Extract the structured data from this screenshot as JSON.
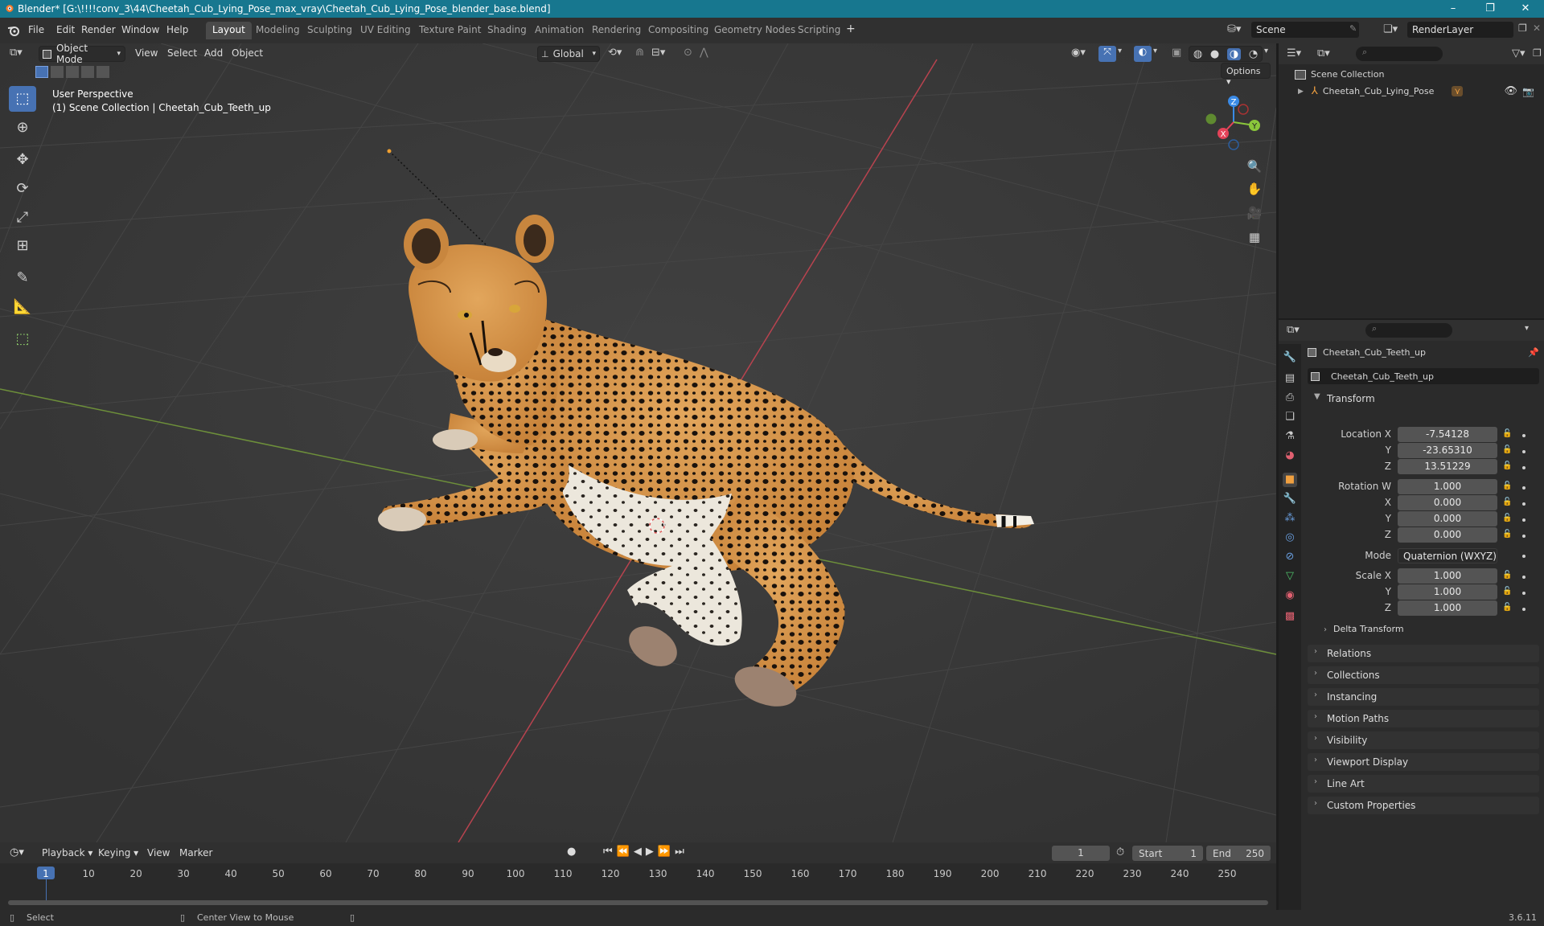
{
  "window": {
    "title": "Blender* [G:\\!!!!conv_3\\44\\Cheetah_Cub_Lying_Pose_max_vray\\Cheetah_Cub_Lying_Pose_blender_base.blend]",
    "controls": [
      "–",
      "❐",
      "✕"
    ]
  },
  "menubar": {
    "menus": [
      "File",
      "Edit",
      "Render",
      "Window",
      "Help"
    ],
    "workspaces": [
      "Layout",
      "Modeling",
      "Sculpting",
      "UV Editing",
      "Texture Paint",
      "Shading",
      "Animation",
      "Rendering",
      "Compositing",
      "Geometry Nodes",
      "Scripting"
    ],
    "active_workspace": "Layout",
    "add_workspace": "+",
    "scene": "Scene",
    "render_layer": "RenderLayer"
  },
  "viewport": {
    "mode": "Object Mode",
    "menus": [
      "View",
      "Select",
      "Add",
      "Object"
    ],
    "orientation": "Global",
    "options": "Options",
    "perspective_label": "User Perspective",
    "collection_label": "(1) Scene Collection | Cheetah_Cub_Teeth_up",
    "gizmo_axes": {
      "x": "X",
      "y": "Y",
      "z": "Z"
    }
  },
  "outliner": {
    "root": "Scene Collection",
    "items": [
      {
        "label": "Cheetah_Cub_Lying_Pose"
      }
    ]
  },
  "properties": {
    "object_name": "Cheetah_Cub_Teeth_up",
    "data_name": "Cheetah_Cub_Teeth_up",
    "transform": {
      "header": "Transform",
      "location_label": "Location X",
      "location": [
        "-7.54128",
        "-23.65310",
        "13.51229"
      ],
      "rotation_label": "Rotation W",
      "rotation": [
        "1.000",
        "0.000",
        "0.000",
        "0.000"
      ],
      "mode_label": "Mode",
      "mode": "Quaternion (WXYZ)",
      "scale_label": "Scale X",
      "scale": [
        "1.000",
        "1.000",
        "1.000"
      ],
      "axis_y": "Y",
      "axis_z": "Z",
      "axis_x": "X",
      "delta": "Delta Transform"
    },
    "panels": [
      "Relations",
      "Collections",
      "Instancing",
      "Motion Paths",
      "Visibility",
      "Viewport Display",
      "Line Art",
      "Custom Properties"
    ]
  },
  "timeline": {
    "menus": [
      "Playback",
      "Keying",
      "View",
      "Marker"
    ],
    "current_frame": "1",
    "start_label": "Start",
    "start": "1",
    "end_label": "End",
    "end": "250",
    "ruler": [
      "1",
      "10",
      "20",
      "30",
      "40",
      "50",
      "60",
      "70",
      "80",
      "90",
      "100",
      "110",
      "120",
      "130",
      "140",
      "150",
      "160",
      "170",
      "180",
      "190",
      "200",
      "210",
      "220",
      "230",
      "240",
      "250"
    ]
  },
  "statusbar": {
    "select": "Select",
    "center_view": "Center View to Mouse",
    "version": "3.6.11"
  },
  "colors": {
    "titlebar": "#17778f",
    "accent": "#4772b3",
    "x_axis": "#e44359",
    "y_axis": "#8ac63b",
    "z_axis": "#3a8ae6"
  }
}
